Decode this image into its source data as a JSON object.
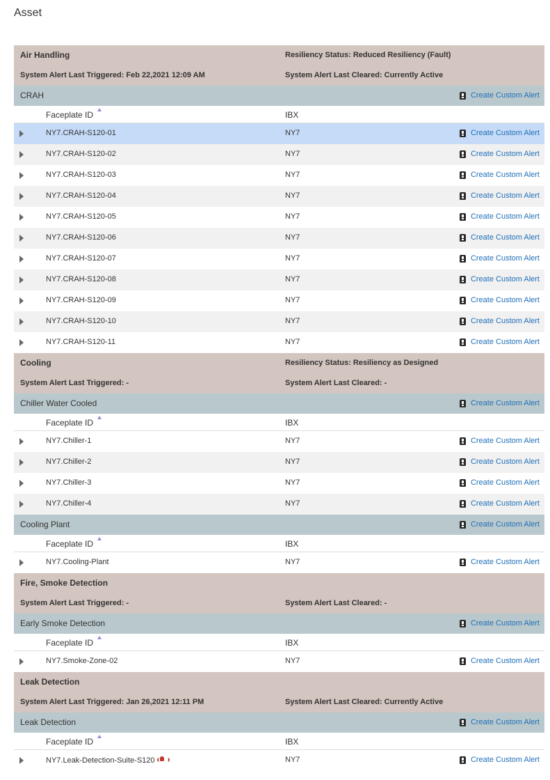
{
  "page": {
    "title": "Asset"
  },
  "labels": {
    "create_custom_alert": "Create Custom Alert",
    "faceplate_id": "Faceplate ID",
    "ibx": "IBX"
  },
  "categories": [
    {
      "name": "Air Handling",
      "resiliency": "Resiliency Status: Reduced Resiliency (Fault)",
      "triggered": "System Alert Last Triggered: Feb 22,2021 12:09 AM",
      "cleared": "System Alert Last Cleared: Currently Active",
      "groups": [
        {
          "name": "CRAH",
          "rows": [
            {
              "id": "NY7.CRAH-S120-01",
              "ibx": "NY7",
              "selected": true
            },
            {
              "id": "NY7.CRAH-S120-02",
              "ibx": "NY7"
            },
            {
              "id": "NY7.CRAH-S120-03",
              "ibx": "NY7"
            },
            {
              "id": "NY7.CRAH-S120-04",
              "ibx": "NY7"
            },
            {
              "id": "NY7.CRAH-S120-05",
              "ibx": "NY7"
            },
            {
              "id": "NY7.CRAH-S120-06",
              "ibx": "NY7"
            },
            {
              "id": "NY7.CRAH-S120-07",
              "ibx": "NY7"
            },
            {
              "id": "NY7.CRAH-S120-08",
              "ibx": "NY7"
            },
            {
              "id": "NY7.CRAH-S120-09",
              "ibx": "NY7"
            },
            {
              "id": "NY7.CRAH-S120-10",
              "ibx": "NY7"
            },
            {
              "id": "NY7.CRAH-S120-11",
              "ibx": "NY7"
            }
          ]
        }
      ]
    },
    {
      "name": "Cooling",
      "resiliency": "Resiliency Status: Resiliency as Designed",
      "triggered": "System Alert Last Triggered: -",
      "cleared": "System Alert Last Cleared: -",
      "groups": [
        {
          "name": "Chiller Water Cooled",
          "rows": [
            {
              "id": "NY7.Chiller-1",
              "ibx": "NY7"
            },
            {
              "id": "NY7.Chiller-2",
              "ibx": "NY7"
            },
            {
              "id": "NY7.Chiller-3",
              "ibx": "NY7"
            },
            {
              "id": "NY7.Chiller-4",
              "ibx": "NY7"
            }
          ]
        },
        {
          "name": "Cooling Plant",
          "rows": [
            {
              "id": "NY7.Cooling-Plant",
              "ibx": "NY7"
            }
          ]
        }
      ]
    },
    {
      "name": "Fire, Smoke Detection",
      "resiliency": "",
      "triggered": "System Alert Last Triggered: -",
      "cleared": "System Alert Last Cleared: -",
      "groups": [
        {
          "name": "Early Smoke Detection",
          "rows": [
            {
              "id": "NY7.Smoke-Zone-02",
              "ibx": "NY7"
            }
          ]
        }
      ]
    },
    {
      "name": "Leak Detection",
      "resiliency": "",
      "triggered": "System Alert Last Triggered: Jan 26,2021 12:11 PM",
      "cleared": "System Alert Last Cleared: Currently Active",
      "groups": [
        {
          "name": "Leak Detection",
          "rows": [
            {
              "id": "NY7.Leak-Detection-Suite-S120",
              "ibx": "NY7",
              "alarm_icon": "alarm-bell-icon"
            }
          ]
        }
      ]
    }
  ],
  "colors": {
    "category_header": "#d3c5bf",
    "group_header": "#b9c8cc",
    "row_alt": "#f1f1f1",
    "row_selected": "#c5dbf7",
    "link": "#1f6fb7",
    "alarm": "#c0392b"
  }
}
